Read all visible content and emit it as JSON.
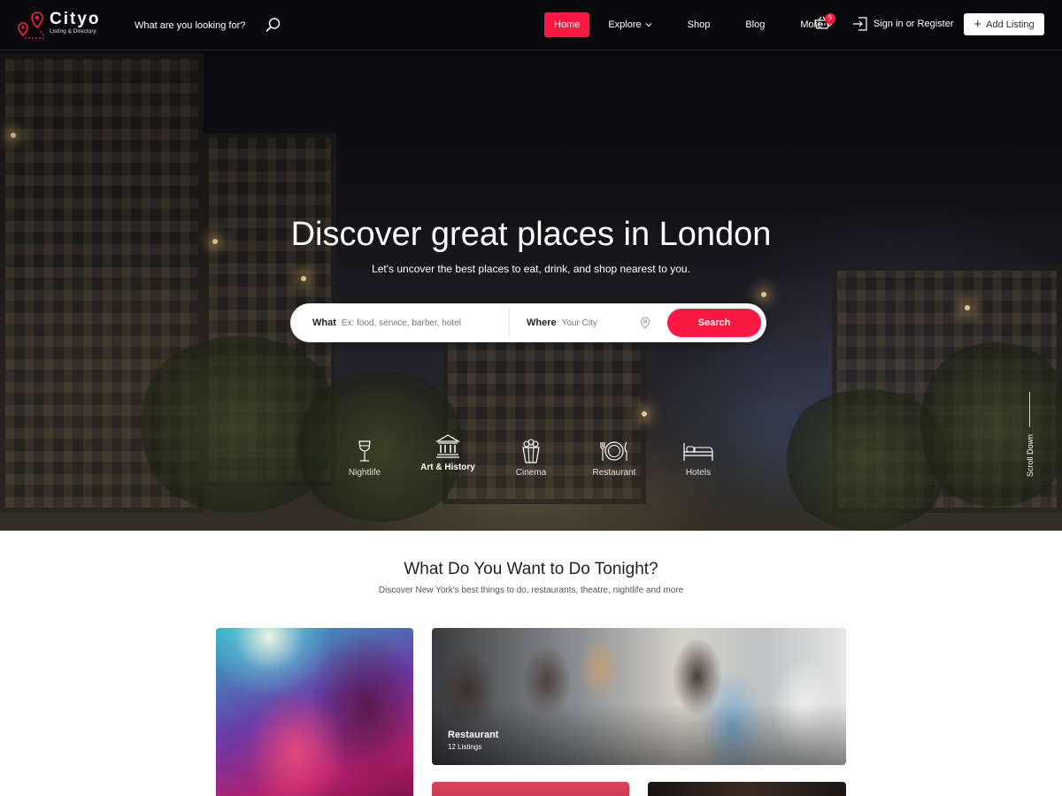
{
  "brand": {
    "name": "Cityo",
    "tagline": "Listing & Directory",
    "icon": "map-pin-icon",
    "accent_color": "#f91942"
  },
  "header": {
    "search_prompt": "What are you looking for?",
    "search_icon": "search-icon",
    "nav": [
      {
        "label": "Home",
        "active": true
      },
      {
        "label": "Explore",
        "dropdown": true
      },
      {
        "label": "Shop"
      },
      {
        "label": "Blog"
      },
      {
        "label": "More",
        "dropdown": true
      }
    ],
    "cart": {
      "icon": "cart-icon",
      "count": "5"
    },
    "signin_label": "Sign in or Register",
    "add_listing_label": "Add Listing"
  },
  "hero": {
    "title": "Discover great places in London",
    "subtitle": "Let's uncover the best places to eat, drink, and shop nearest to you.",
    "search": {
      "what_label": "What",
      "what_placeholder": "Ex: food, service, barber, hotel",
      "where_label": "Where",
      "where_placeholder": "Your City",
      "button_label": "Search"
    },
    "categories": [
      {
        "label": "Nightlife",
        "icon": "wine-glass-icon"
      },
      {
        "label": "Art & History",
        "icon": "museum-icon",
        "active": true
      },
      {
        "label": "Cinema",
        "icon": "popcorn-icon"
      },
      {
        "label": "Restaurant",
        "icon": "dining-icon"
      },
      {
        "label": "Hotels",
        "icon": "bed-icon"
      }
    ],
    "scroll_label": "Scroll Down"
  },
  "section": {
    "title": "What Do You Want to Do Tonight?",
    "subtitle": "Discover New York's best things to do, restaurants, theatre, nightlife and more",
    "cards": [
      {
        "name": "Restaurant",
        "count": "12 Listings"
      }
    ]
  }
}
